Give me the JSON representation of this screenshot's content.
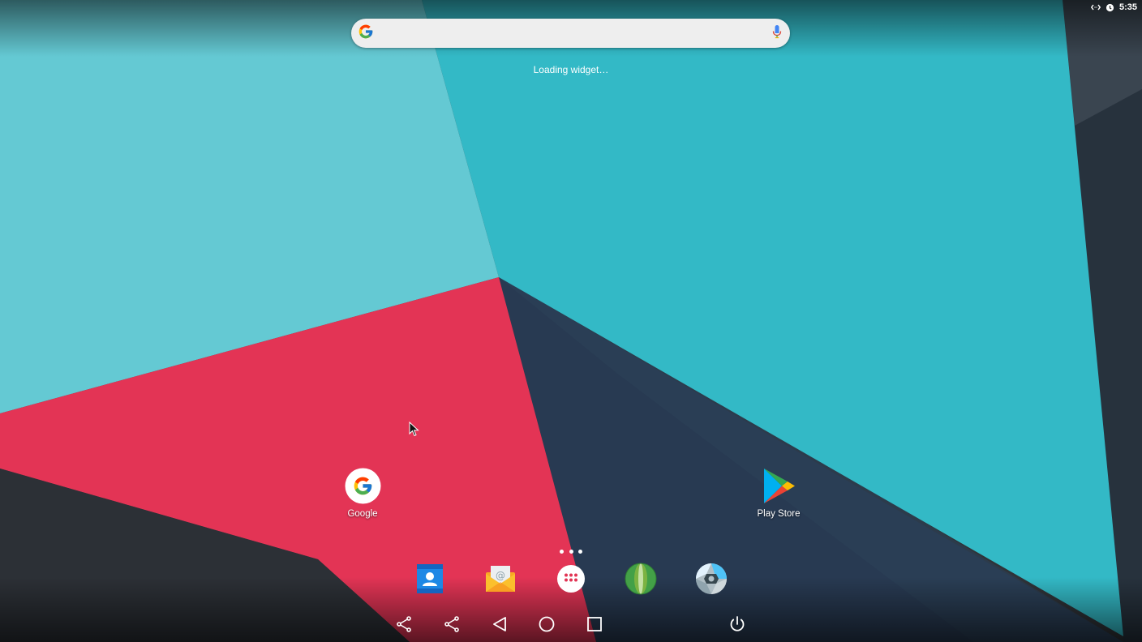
{
  "status_bar": {
    "time": "5:35",
    "icons": [
      "code-arrows-icon",
      "alarm-icon"
    ]
  },
  "search": {
    "placeholder": "",
    "logo": "google-g-icon",
    "mic": "microphone-icon"
  },
  "widget": {
    "loading_text": "Loading widget…"
  },
  "desktop_icons": [
    {
      "label": "Google",
      "icon": "google-app-icon"
    },
    {
      "label": "Play Store",
      "icon": "play-store-icon"
    }
  ],
  "dock": [
    "contacts-icon",
    "email-icon",
    "app-drawer-icon",
    "browser-icon",
    "camera-icon"
  ],
  "nav_bar": [
    "share-icon",
    "share-alt-icon",
    "back-icon",
    "home-icon",
    "recents-icon",
    "power-icon"
  ],
  "colors": {
    "teal_light": "#62c9d3",
    "teal": "#33b9c6",
    "red": "#e23454",
    "navy": "#2a3a52",
    "dark": "#2b2f35"
  }
}
